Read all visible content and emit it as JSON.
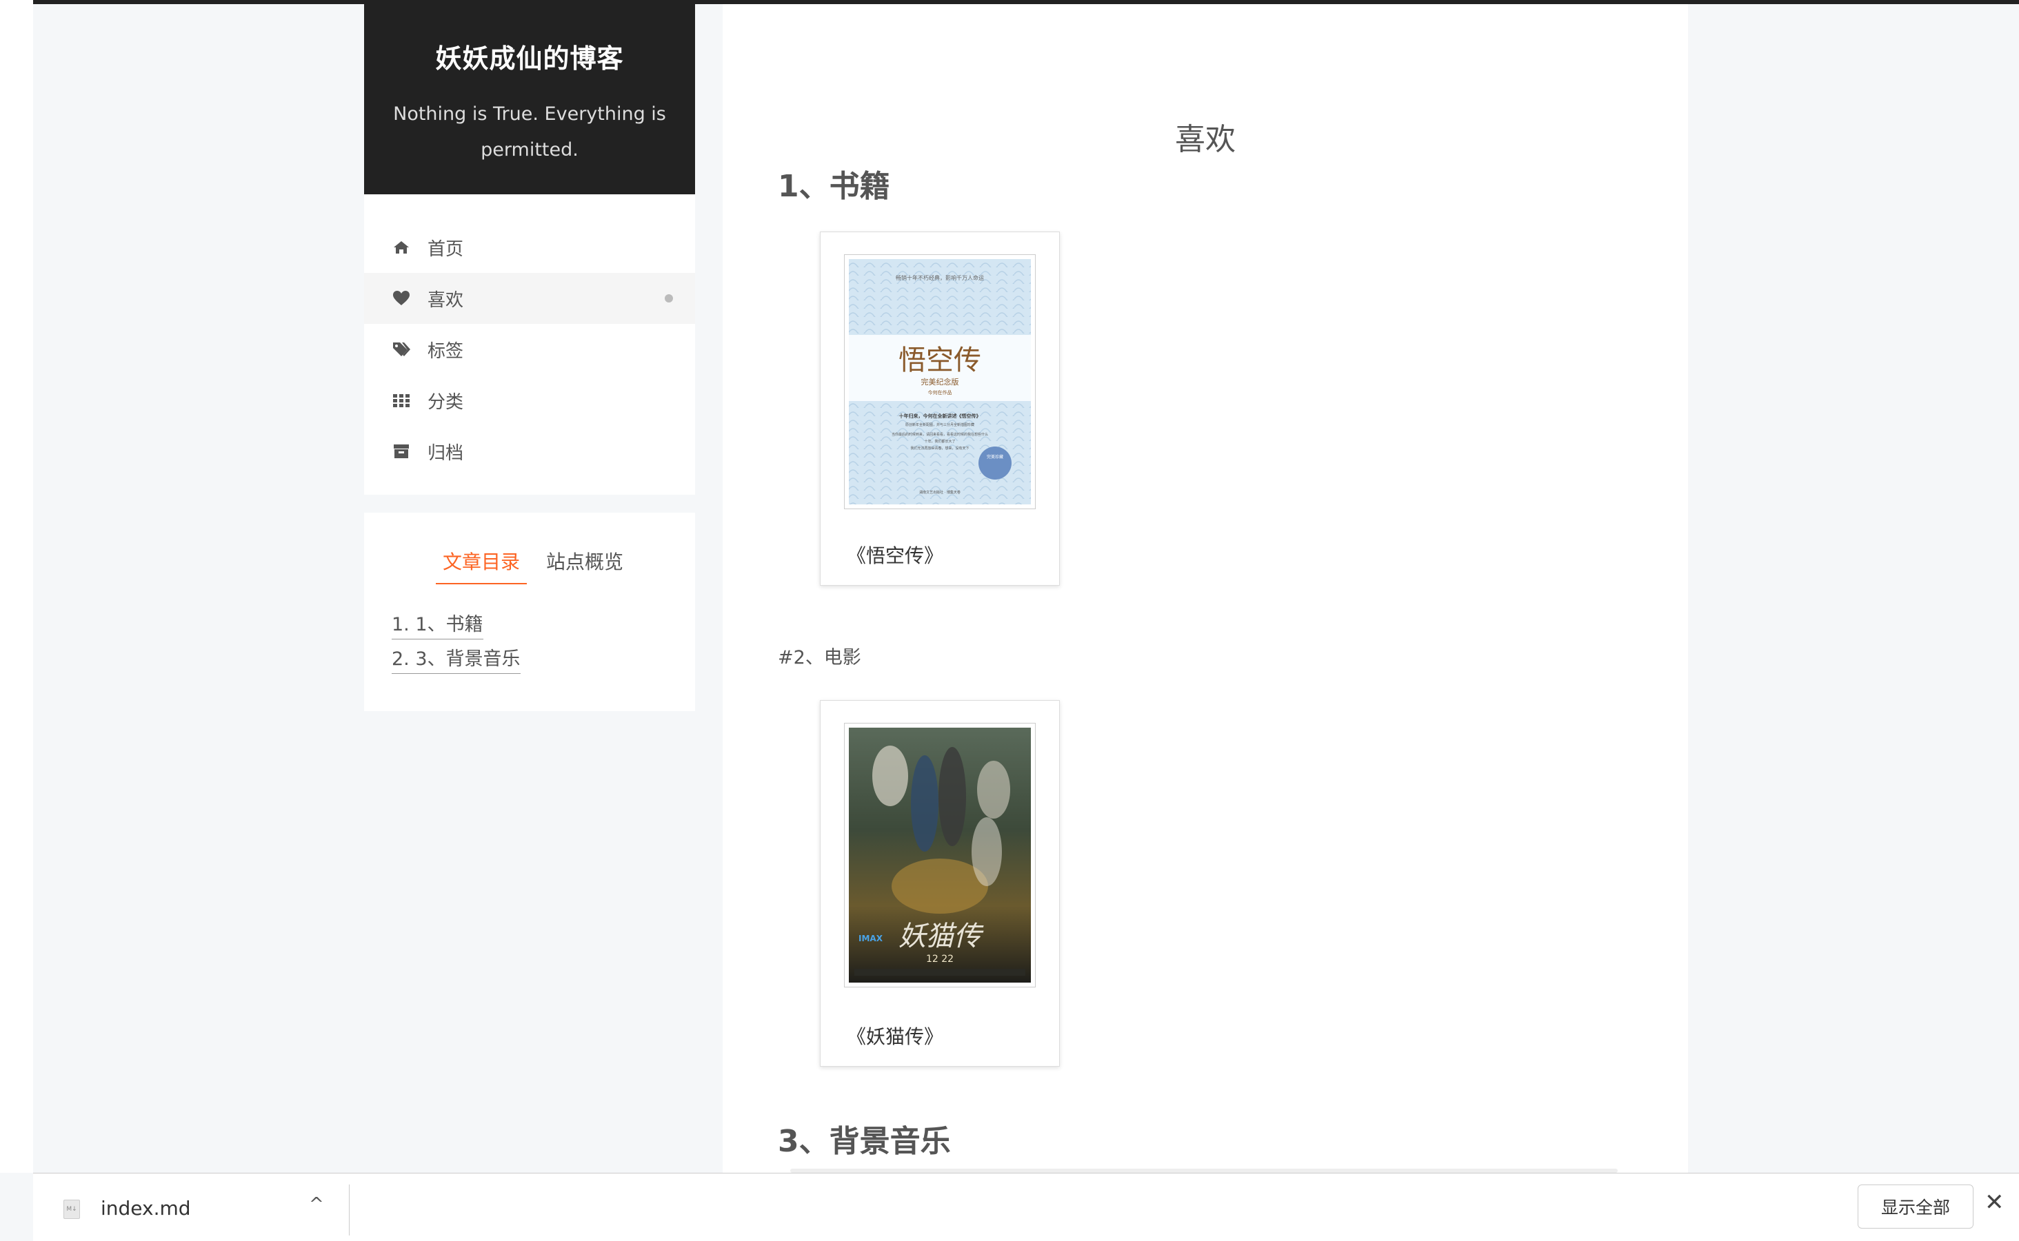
{
  "site": {
    "title": "妖妖成仙的博客",
    "subtitle": "Nothing is True. Everything is permitted."
  },
  "menu": {
    "items": [
      {
        "label": "首页",
        "icon": "home-icon"
      },
      {
        "label": "喜欢",
        "icon": "heart-icon",
        "active": true
      },
      {
        "label": "标签",
        "icon": "tags-icon"
      },
      {
        "label": "分类",
        "icon": "grid-icon"
      },
      {
        "label": "归档",
        "icon": "archive-icon"
      }
    ]
  },
  "toc": {
    "tabs": [
      "文章目录",
      "站点概览"
    ],
    "links": [
      "1. 1、书籍",
      "2. 3、背景音乐"
    ]
  },
  "post": {
    "title": "喜欢",
    "sections": {
      "books": "1、书籍",
      "movies": "#2、电影",
      "music": "3、背景音乐"
    },
    "book_cards": [
      {
        "caption": "《悟空传》",
        "cover": {
          "top_line": "畅销十年不朽经典，影响千万人命运",
          "art_title": "悟空传",
          "edition": "完美纪念版",
          "author_line": "今何在作品",
          "blurb": [
            "十年归来，今何在全新讲述《悟空传》",
            "原创新年全新配图，并与三分月全新插图珍藏",
            "当你最后的时候到来，请回来看看，看看这时候的我在想些什么",
            "十年，我们都长大了",
            "我们无法再放纵青春，想来，没有天下"
          ],
          "seal": "完美珍藏",
          "publisher": "湖南文艺出版社 · 博集天卷"
        }
      }
    ],
    "movie_cards": [
      {
        "caption": "《妖猫传》",
        "poster": {
          "title": "妖猫传",
          "brand": "IMAX",
          "release_date": "12 22"
        }
      }
    ]
  },
  "download_bar": {
    "file_name": "index.md",
    "file_icon_text": "M↓",
    "show_all_label": "显示全部",
    "chevron": "^",
    "close_glyph": "✕"
  },
  "colors": {
    "accent": "#fc6423",
    "header_bg": "#222222",
    "page_bg": "#f5f7f9"
  }
}
